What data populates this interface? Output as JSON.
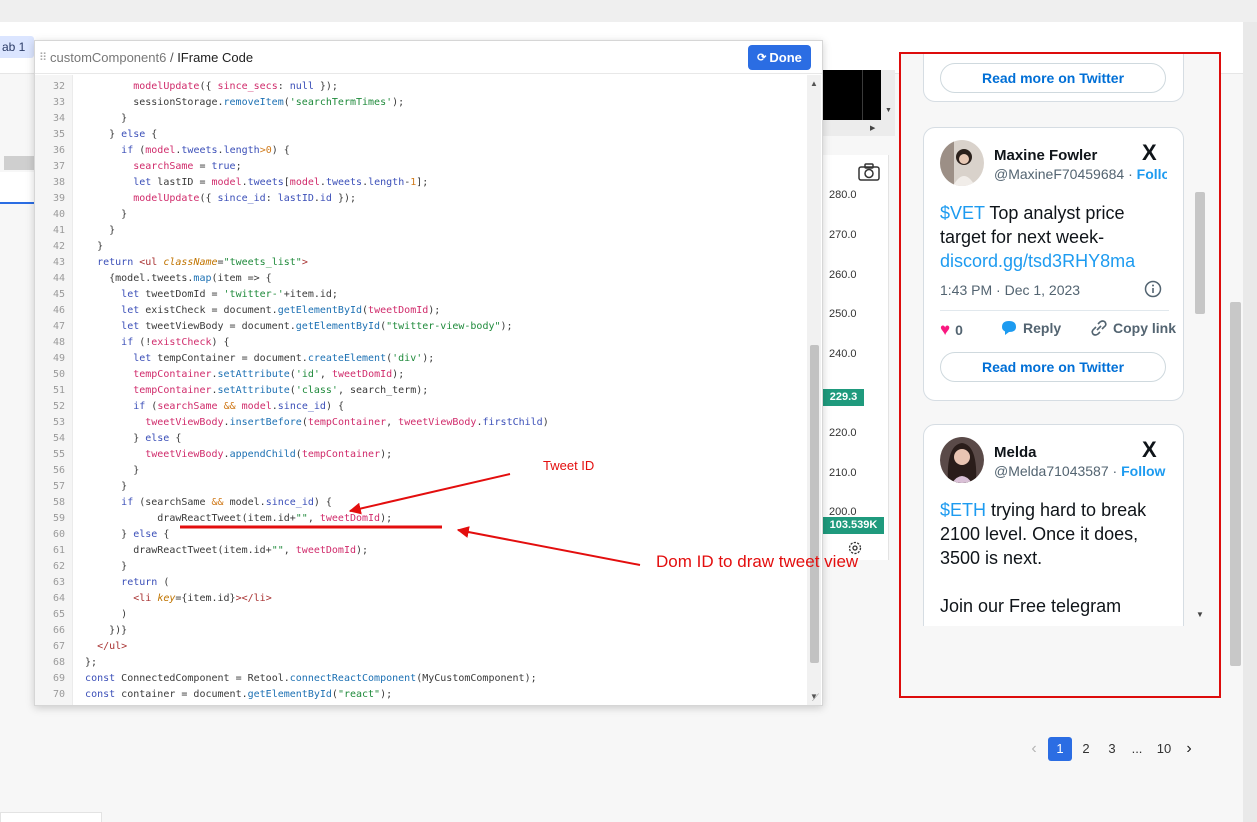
{
  "editor": {
    "component_name": "customComponent6",
    "separator": " / ",
    "page_name": "IFrame Code",
    "done_label": "Done",
    "code_lines": [
      {
        "n": "32",
        "html": "          <span class=\"v\">modelUpdate</span>({ <span class=\"v\">since_secs</span>: <span class=\"kw\">null</span> });"
      },
      {
        "n": "33",
        "html": "          sessionStorage.<span class=\"fn\">removeItem</span>(<span class=\"s\">'searchTermTimes'</span>);"
      },
      {
        "n": "34",
        "html": "        }"
      },
      {
        "n": "35",
        "html": "      } <span class=\"kw\">else</span> {"
      },
      {
        "n": "36",
        "html": "        <span class=\"kw\">if</span> (<span class=\"v\">model</span>.<span class=\"kw\">tweets</span>.<span class=\"kw\">length</span><span class=\"num\">&gt;0</span>) {"
      },
      {
        "n": "37",
        "html": "          <span class=\"v\">searchSame</span> = <span class=\"kw\">true</span>;"
      },
      {
        "n": "38",
        "html": "          <span class=\"kw\">let</span> lastID = <span class=\"v\">model</span>.<span class=\"kw\">tweets</span>[<span class=\"v\">model</span>.<span class=\"kw\">tweets</span>.<span class=\"kw\">length</span>-<span class=\"num\">1</span>];"
      },
      {
        "n": "39",
        "html": "          <span class=\"v\">modelUpdate</span>({ <span class=\"kw\">since_id</span>: <span class=\"kw\">lastID</span>.<span class=\"kw\">id</span> });"
      },
      {
        "n": "40",
        "html": "        }"
      },
      {
        "n": "41",
        "html": "      }"
      },
      {
        "n": "42",
        "html": "    }"
      },
      {
        "n": "43",
        "html": "    <span class=\"kw\">return</span> <span class=\"tag\">&lt;ul</span> <span class=\"attr\">className</span>=<span class=\"s\">\"tweets_list\"</span><span class=\"tag\">&gt;</span>"
      },
      {
        "n": "44",
        "html": "      {model.tweets.<span class=\"fn\">map</span>(item =&gt; {"
      },
      {
        "n": "45",
        "html": "        <span class=\"kw\">let</span> tweetDomId = <span class=\"s\">'twitter-'</span>+item.id;"
      },
      {
        "n": "46",
        "html": "        <span class=\"kw\">let</span> existCheck = document.<span class=\"fn\">getElementById</span>(<span class=\"v\">tweetDomId</span>);"
      },
      {
        "n": "47",
        "html": "        <span class=\"kw\">let</span> tweetViewBody = document.<span class=\"fn\">getElementById</span>(<span class=\"s\">\"twitter-view-body\"</span>);"
      },
      {
        "n": "48",
        "html": "        <span class=\"kw\">if</span> (!<span class=\"v\">existCheck</span>) {"
      },
      {
        "n": "49",
        "html": "          <span class=\"kw\">let</span> tempContainer = document.<span class=\"fn\">createElement</span>(<span class=\"s\">'div'</span>);"
      },
      {
        "n": "50",
        "html": "          <span class=\"v\">tempContainer</span>.<span class=\"fn\">setAttribute</span>(<span class=\"s\">'id'</span>, <span class=\"v\">tweetDomId</span>);"
      },
      {
        "n": "51",
        "html": "          <span class=\"v\">tempContainer</span>.<span class=\"fn\">setAttribute</span>(<span class=\"s\">'class'</span>, search_term);"
      },
      {
        "n": "52",
        "html": "          <span class=\"kw\">if</span> (<span class=\"v\">searchSame</span> <span class=\"num\">&amp;&amp;</span> <span class=\"v\">model</span>.<span class=\"kw\">since_id</span>) {"
      },
      {
        "n": "53",
        "html": "            <span class=\"v\">tweetViewBody</span>.<span class=\"fn\">insertBefore</span>(<span class=\"v\">tempContainer</span>, <span class=\"v\">tweetViewBody</span>.<span class=\"kw\">firstChild</span>)"
      },
      {
        "n": "54",
        "html": "          } <span class=\"kw\">else</span> {"
      },
      {
        "n": "55",
        "html": "            <span class=\"v\">tweetViewBody</span>.<span class=\"fn\">appendChild</span>(<span class=\"v\">tempContainer</span>);"
      },
      {
        "n": "56",
        "html": "          }"
      },
      {
        "n": "57",
        "html": "        }"
      },
      {
        "n": "58",
        "html": "        <span class=\"kw\">if</span> (searchSame <span class=\"num\">&amp;&amp;</span> model.<span class=\"kw\">since_id</span>) {"
      },
      {
        "n": "59",
        "html": "              drawReactTweet(item.id+<span class=\"s\">\"\"</span>, <span class=\"v\">tweetDomId</span>);"
      },
      {
        "n": "60",
        "html": "        } <span class=\"kw\">else</span> {"
      },
      {
        "n": "61",
        "html": "          drawReactTweet(item.id+<span class=\"s\">\"\"</span>, <span class=\"v\">tweetDomId</span>);"
      },
      {
        "n": "62",
        "html": "        }"
      },
      {
        "n": "63",
        "html": "        <span class=\"kw\">return</span> ("
      },
      {
        "n": "64",
        "html": "          <span class=\"tag\">&lt;li</span> <span class=\"attr\">key</span>={item.id}<span class=\"tag\">&gt;&lt;/li&gt;</span>"
      },
      {
        "n": "65",
        "html": "        )"
      },
      {
        "n": "66",
        "html": "      })}"
      },
      {
        "n": "67",
        "html": "    <span class=\"tag\">&lt;/ul&gt;</span>"
      },
      {
        "n": "68",
        "html": "  };"
      },
      {
        "n": "69",
        "html": "  <span class=\"kw\">const</span> ConnectedComponent = Retool.<span class=\"fn\">connectReactComponent</span>(MyCustomComponent);"
      },
      {
        "n": "70",
        "html": "  <span class=\"kw\">const</span> container = document.<span class=\"fn\">getElementById</span>(<span class=\"s\">\"react\"</span>);"
      }
    ]
  },
  "left_panel": {
    "tab_label": "ab 1"
  },
  "chart": {
    "ticks": [
      "280.0",
      "270.0",
      "260.0",
      "250.0",
      "240.0",
      "220.0",
      "210.0",
      "200.0"
    ],
    "price_label": "229.3",
    "volume_label": "103.539K"
  },
  "annotations": {
    "tweet_id": "Tweet ID",
    "dom_id": "Dom ID to draw tweet view"
  },
  "tweets": {
    "top_card_read_more": "Read more on Twitter",
    "items": [
      {
        "name": "Maxine Fowler",
        "handle": "@MaxineF70459684",
        "separator": " · ",
        "follow": "Follow",
        "cashtag": "$VET",
        "text": " Top analyst price target for next week-",
        "link": "discord.gg/tsd3RHY8ma",
        "time": "1:43 PM · Dec 1, 2023",
        "likes": "0",
        "reply": "Reply",
        "copy": "Copy link",
        "read_more": "Read more on Twitter"
      },
      {
        "name": "Melda",
        "handle": "@Melda71043587",
        "separator": " · ",
        "follow": "Follow",
        "cashtag": "$ETH",
        "text": " trying hard to break 2100 level. Once it does, 3500 is next.",
        "text2": "Join our Free telegram"
      }
    ]
  },
  "pagination": {
    "prev": "‹",
    "pages": [
      "1",
      "2",
      "3"
    ],
    "ellipsis": "...",
    "last": "10",
    "next": "›",
    "active": "1"
  },
  "colors": {
    "accent": "#2b6de3",
    "annotation_red": "#e30e0e",
    "twitter_blue": "#1d9bf0",
    "chart_badge": "#1f9a7d"
  }
}
